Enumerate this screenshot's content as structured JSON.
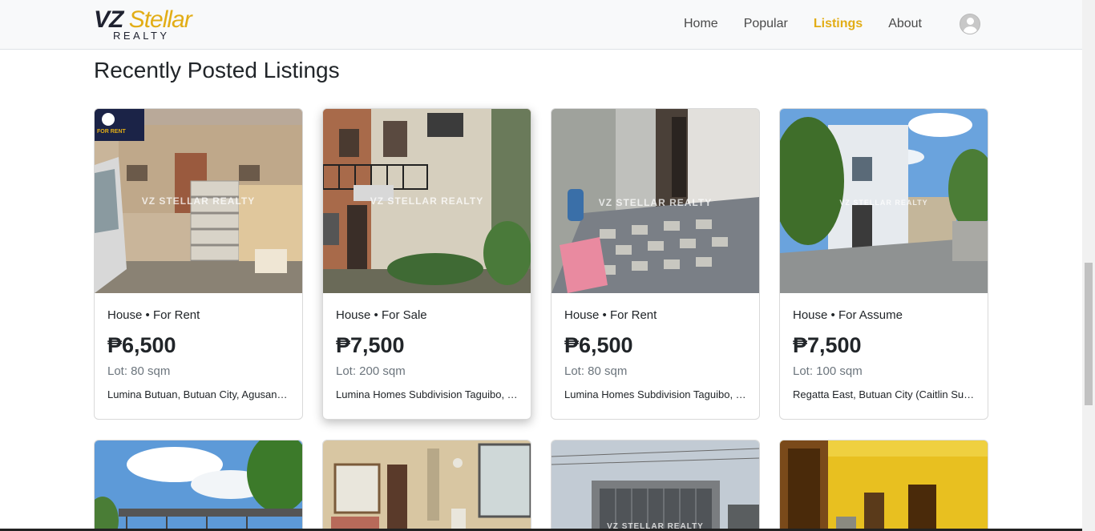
{
  "brand": {
    "name_part1": "VZ",
    "name_part2": "Stellar",
    "subtitle": "REALTY"
  },
  "nav": {
    "links": [
      {
        "label": "Home",
        "active": false
      },
      {
        "label": "Popular",
        "active": false
      },
      {
        "label": "Listings",
        "active": true
      },
      {
        "label": "About",
        "active": false
      }
    ],
    "accent_color": "#e2ad16"
  },
  "section": {
    "title": "Recently Posted Listings"
  },
  "listings": [
    {
      "type": "House • For Rent",
      "price": "₱6,500",
      "lot": "Lot: 80 sqm",
      "location": "Lumina Butuan, Butuan City, Agusan del Norte",
      "watermark": "VZ STELLAR REALTY",
      "badge": "FOR RENT"
    },
    {
      "type": "House • For Sale",
      "price": "₱7,500",
      "lot": "Lot: 200 sqm",
      "location": "Lumina Homes Subdivision Taguibo, Butuan City",
      "watermark": "VZ STELLAR REALTY"
    },
    {
      "type": "House • For Rent",
      "price": "₱6,500",
      "lot": "Lot: 80 sqm",
      "location": "Lumina Homes Subdivision Taguibo, Butuan City",
      "watermark": "VZ STELLAR REALTY"
    },
    {
      "type": "House • For Assume",
      "price": "₱7,500",
      "lot": "Lot: 100 sqm",
      "location": "Regatta East, Butuan City (Caitlin Subdivision)",
      "watermark": "VZ STELLAR REALTY"
    }
  ],
  "listings_row2": [
    {
      "watermark": ""
    },
    {
      "watermark": ""
    },
    {
      "watermark": "VZ STELLAR REALTY"
    },
    {
      "watermark": ""
    }
  ]
}
